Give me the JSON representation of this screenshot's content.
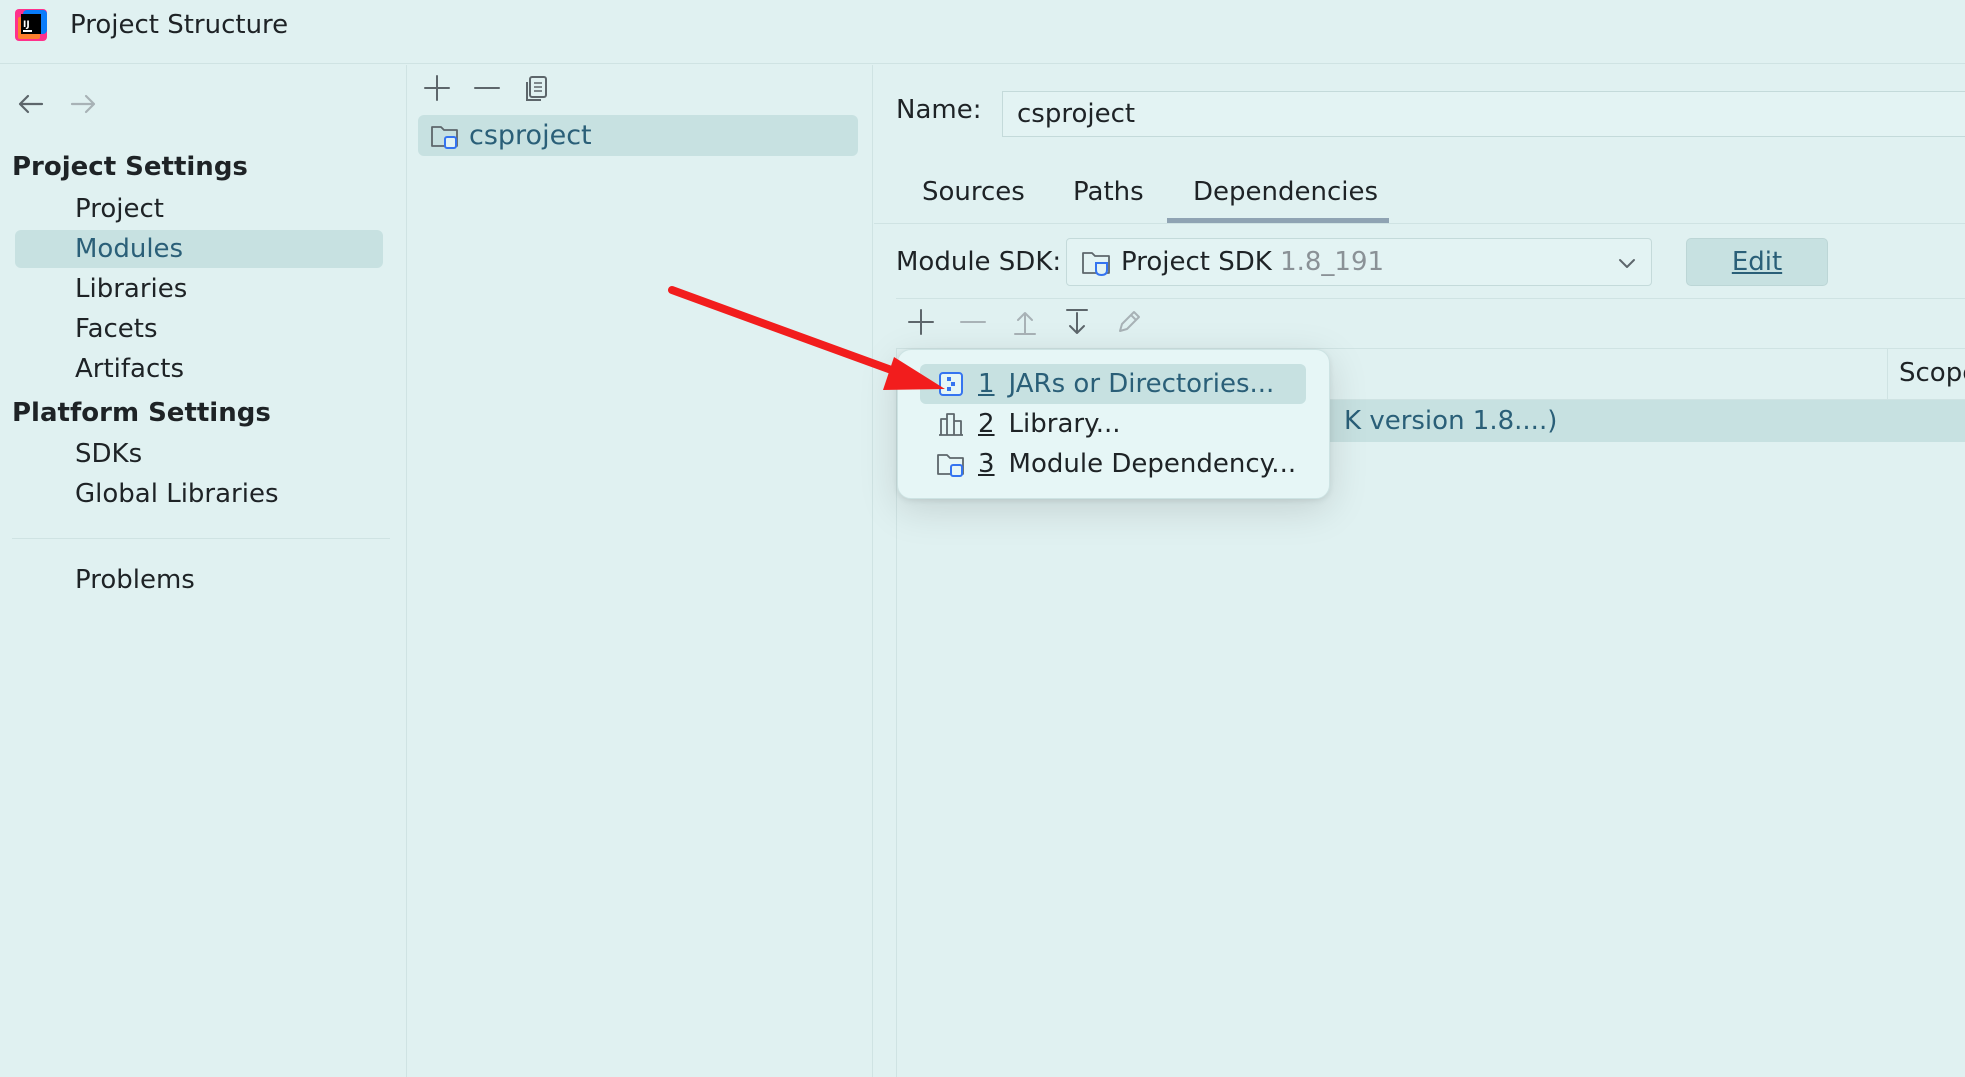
{
  "window": {
    "title": "Project Structure"
  },
  "nav": {
    "back_icon": "arrow-left-icon",
    "forward_icon": "arrow-right-icon",
    "project_settings_header": "Project Settings",
    "project_settings_items": [
      "Project",
      "Modules",
      "Libraries",
      "Facets",
      "Artifacts"
    ],
    "platform_settings_header": "Platform Settings",
    "platform_settings_items": [
      "SDKs",
      "Global Libraries"
    ],
    "problems": "Problems",
    "selected": "Modules"
  },
  "modules": {
    "toolbar_icons": [
      "plus-icon",
      "minus-icon",
      "copy-icon"
    ],
    "items": [
      "csproject"
    ]
  },
  "module_details": {
    "name_label": "Name:",
    "name_value": "csproject",
    "tabs": [
      "Sources",
      "Paths",
      "Dependencies"
    ],
    "active_tab": "Dependencies",
    "sdk_label": "Module SDK:",
    "sdk_name": "Project SDK",
    "sdk_version": "1.8_191",
    "edit_button": "Edit",
    "dep_toolbar_icons": [
      "plus-icon",
      "minus-icon",
      "move-up-icon",
      "move-down-icon",
      "edit-pencil-icon"
    ],
    "scope_header": "Scope",
    "dependency_row_text": "K version 1.8....)"
  },
  "add_popup": {
    "items": [
      {
        "num": "1",
        "label": "JARs or Directories...",
        "icon": "jar-icon"
      },
      {
        "num": "2",
        "label": "Library...",
        "icon": "library-icon"
      },
      {
        "num": "3",
        "label": "Module Dependency...",
        "icon": "module-folder-icon"
      }
    ]
  },
  "colors": {
    "background": "#e0f1f1",
    "selection": "#c7e1e1",
    "selected_text": "#2a5f78",
    "annotation_arrow": "#f21d1d"
  }
}
